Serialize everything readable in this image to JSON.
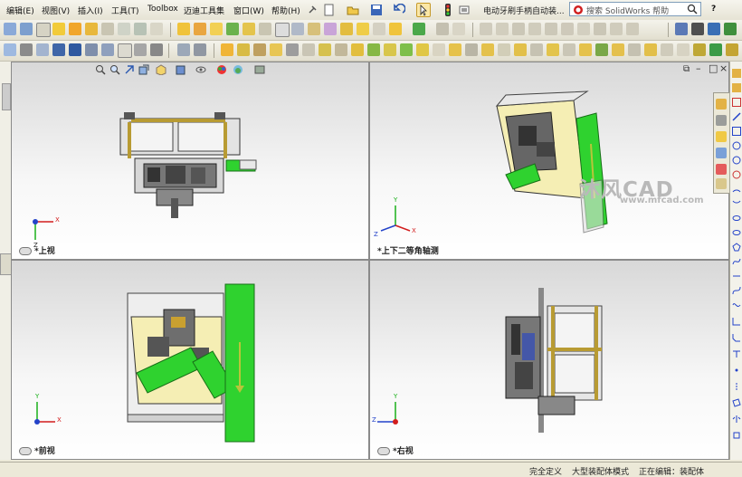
{
  "menubar": {
    "items": [
      "编辑(E)",
      "视图(V)",
      "插入(I)",
      "工具(T)",
      "Toolbox",
      "迈迪工具集",
      "窗口(W)",
      "帮助(H)"
    ]
  },
  "document_title": "电动牙刷手柄自动装...",
  "search": {
    "placeholder": "搜索 SolidWorks 帮助"
  },
  "help_label": "?",
  "viewports": {
    "top_left": {
      "label": "*上视"
    },
    "top_right": {
      "label": "*上下二等角轴测"
    },
    "bottom_left": {
      "label": "*前视"
    },
    "bottom_right": {
      "label": "*右视"
    }
  },
  "axes": {
    "x": "X",
    "y": "Y",
    "z": "Z"
  },
  "watermark": {
    "brand": "沐风CAD",
    "url": "www.mfcad.com"
  },
  "statusbar": {
    "status1": "完全定义",
    "status2": "大型装配体模式",
    "status3": "正在编辑：装配体"
  },
  "colors": {
    "accent_green": "#2fd22f",
    "cream": "#f5eeb4",
    "toolbar_bg": "#ece9d8"
  }
}
